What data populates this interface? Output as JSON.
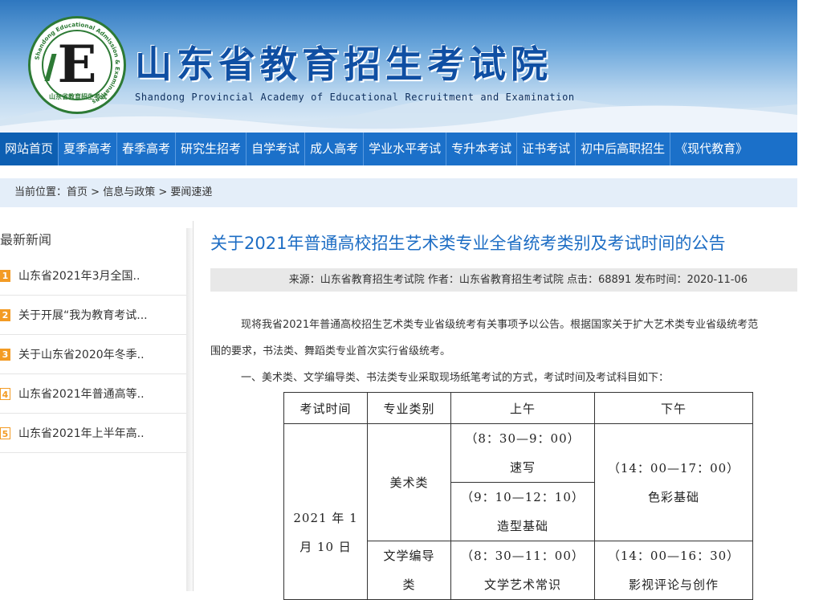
{
  "header": {
    "title": "山东省教育招生考试院",
    "subtitle": "Shandong Provincial Academy of Educational Recruitment and Examination",
    "logo_ring_text": "Shandong Educational Admission & Examinations",
    "logo_bottom_text": "山东省教育招生考试",
    "logo_letter": "E"
  },
  "nav": {
    "items": [
      {
        "label": "网站首页"
      },
      {
        "label": "夏季高考"
      },
      {
        "label": "春季高考"
      },
      {
        "label": "研究生招考"
      },
      {
        "label": "自学考试"
      },
      {
        "label": "成人高考"
      },
      {
        "label": "学业水平考试"
      },
      {
        "label": "专升本考试"
      },
      {
        "label": "证书考试"
      },
      {
        "label": "初中后高职招生"
      },
      {
        "label": "《现代教育》"
      }
    ]
  },
  "breadcrumb": {
    "prefix": "当前位置：",
    "items": [
      "首页",
      "信息与政策",
      "要闻速递"
    ],
    "sep": " > "
  },
  "sidebar": {
    "heading": "最新新闻",
    "items": [
      {
        "num": "1",
        "text": "山东省2021年3月全国.."
      },
      {
        "num": "2",
        "text": "关于开展“我为教育考试..."
      },
      {
        "num": "3",
        "text": "关于山东省2020年冬季.."
      },
      {
        "num": "4",
        "text": "山东省2021年普通高等.."
      },
      {
        "num": "5",
        "text": "山东省2021年上半年高.."
      }
    ]
  },
  "article": {
    "title": "关于2021年普通高校招生艺术类专业全省统考类别及考试时间的公告",
    "meta": "来源：山东省教育招生考试院 作者：山东省教育招生考试院 点击：68891 发布时间：2020-11-06",
    "para1_line1": "现将我省2021年普通高校招生艺术类专业省级统考有关事项予以公告。根据国家关于扩大艺术类专业省级统考范",
    "para1_line2": "围的要求，书法类、舞蹈类专业首次实行省级统考。",
    "para2": "一、美术类、文学编导类、书法类专业采取现场纸笔考试的方式，考试时间及考试科目如下："
  },
  "table": {
    "headers": [
      "考试时间",
      "专业类别",
      "上午",
      "下午"
    ],
    "date_line1": "2021 年 1",
    "date_line2": "月 10 日",
    "art_category": "美术类",
    "art_am1_time": "（8：30—9：00）",
    "art_am1_subject": "速写",
    "art_am2_time": "（9：10—12：10）",
    "art_am2_subject": "造型基础",
    "art_pm_time": "（14：00—17：00）",
    "art_pm_subject": "色彩基础",
    "lit_category_line1": "文学编导",
    "lit_category_line2": "类",
    "lit_am_time": "（8：30—11：00）",
    "lit_am_subject": "文学艺术常识",
    "lit_pm_time": "（14：00—16：30）",
    "lit_pm_subject": "影视评论与创作"
  },
  "colors": {
    "nav_bg": "#1b70c9",
    "title_blue": "#1d6dc4",
    "badge_orange": "#f39b24",
    "logo_green": "#2d7a35"
  }
}
